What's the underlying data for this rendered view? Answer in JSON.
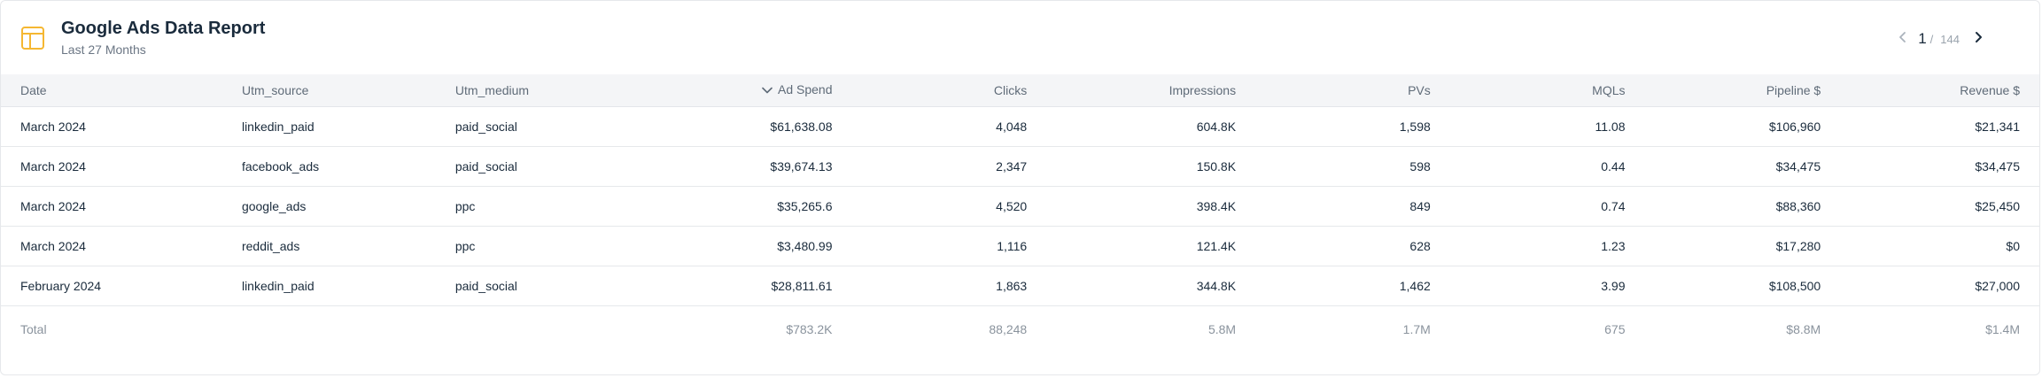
{
  "header": {
    "title": "Google Ads Data Report",
    "subtitle": "Last 27 Months",
    "icon": "table-icon",
    "icon_color": "#f5b731"
  },
  "pagination": {
    "current_page": "1",
    "separator": "/",
    "total_pages": "144"
  },
  "table": {
    "columns": [
      "Date",
      "Utm_source",
      "Utm_medium",
      "Ad Spend",
      "Clicks",
      "Impressions",
      "PVs",
      "MQLs",
      "Pipeline $",
      "Revenue $"
    ],
    "sorted_column": "Ad Spend",
    "sort_direction": "descending",
    "rows": [
      [
        "March 2024",
        "linkedin_paid",
        "paid_social",
        "$61,638.08",
        "4,048",
        "604.8K",
        "1,598",
        "11.08",
        "$106,960",
        "$21,341"
      ],
      [
        "March 2024",
        "facebook_ads",
        "paid_social",
        "$39,674.13",
        "2,347",
        "150.8K",
        "598",
        "0.44",
        "$34,475",
        "$34,475"
      ],
      [
        "March 2024",
        "google_ads",
        "ppc",
        "$35,265.6",
        "4,520",
        "398.4K",
        "849",
        "0.74",
        "$88,360",
        "$25,450"
      ],
      [
        "March 2024",
        "reddit_ads",
        "ppc",
        "$3,480.99",
        "1,116",
        "121.4K",
        "628",
        "1.23",
        "$17,280",
        "$0"
      ],
      [
        "February 2024",
        "linkedin_paid",
        "paid_social",
        "$28,811.61",
        "1,863",
        "344.8K",
        "1,462",
        "3.99",
        "$108,500",
        "$27,000"
      ]
    ],
    "totals": [
      "Total",
      "",
      "",
      "$783.2K",
      "88,248",
      "5.8M",
      "1.7M",
      "675",
      "$8.8M",
      "$1.4M"
    ]
  }
}
